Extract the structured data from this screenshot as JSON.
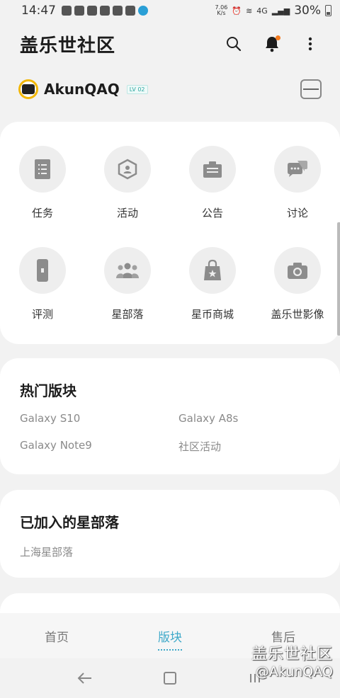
{
  "status_bar": {
    "time": "14:47",
    "net_speed_value": "7.06",
    "net_speed_unit": "K/s",
    "network_label": "4G",
    "battery": "30%"
  },
  "header": {
    "title": "盖乐世社区",
    "search_icon": "search-icon",
    "bell_icon": "bell-icon",
    "more_icon": "more-vertical-icon"
  },
  "user": {
    "name": "AkunQAQ",
    "level": "LV 02"
  },
  "grid": {
    "items": [
      {
        "label": "任务",
        "icon": "task-list-icon"
      },
      {
        "label": "活动",
        "icon": "activity-hexagon-icon"
      },
      {
        "label": "公告",
        "icon": "notice-board-icon"
      },
      {
        "label": "讨论",
        "icon": "chat-bubbles-icon"
      },
      {
        "label": "评测",
        "icon": "phone-review-icon"
      },
      {
        "label": "星部落",
        "icon": "group-people-icon"
      },
      {
        "label": "星币商城",
        "icon": "shopping-bag-star-icon"
      },
      {
        "label": "盖乐世影像",
        "icon": "camera-icon"
      }
    ]
  },
  "hot_sections": {
    "title": "热门版块",
    "links": [
      "Galaxy S10",
      "Galaxy A8s",
      "Galaxy Note9",
      "社区活动"
    ]
  },
  "followed_tribes": {
    "title": "已加入的星部落",
    "links": [
      "上海星部落"
    ]
  },
  "tabs": [
    {
      "label": "首页"
    },
    {
      "label": "版块"
    },
    {
      "label": "售后"
    }
  ],
  "watermark": {
    "title": "盖乐世社区",
    "handle": "@AkunQAQ"
  },
  "colors": {
    "accent": "#3fa9c9",
    "notification_dot": "#f47b20",
    "level_badge": "#2fa7a0"
  }
}
